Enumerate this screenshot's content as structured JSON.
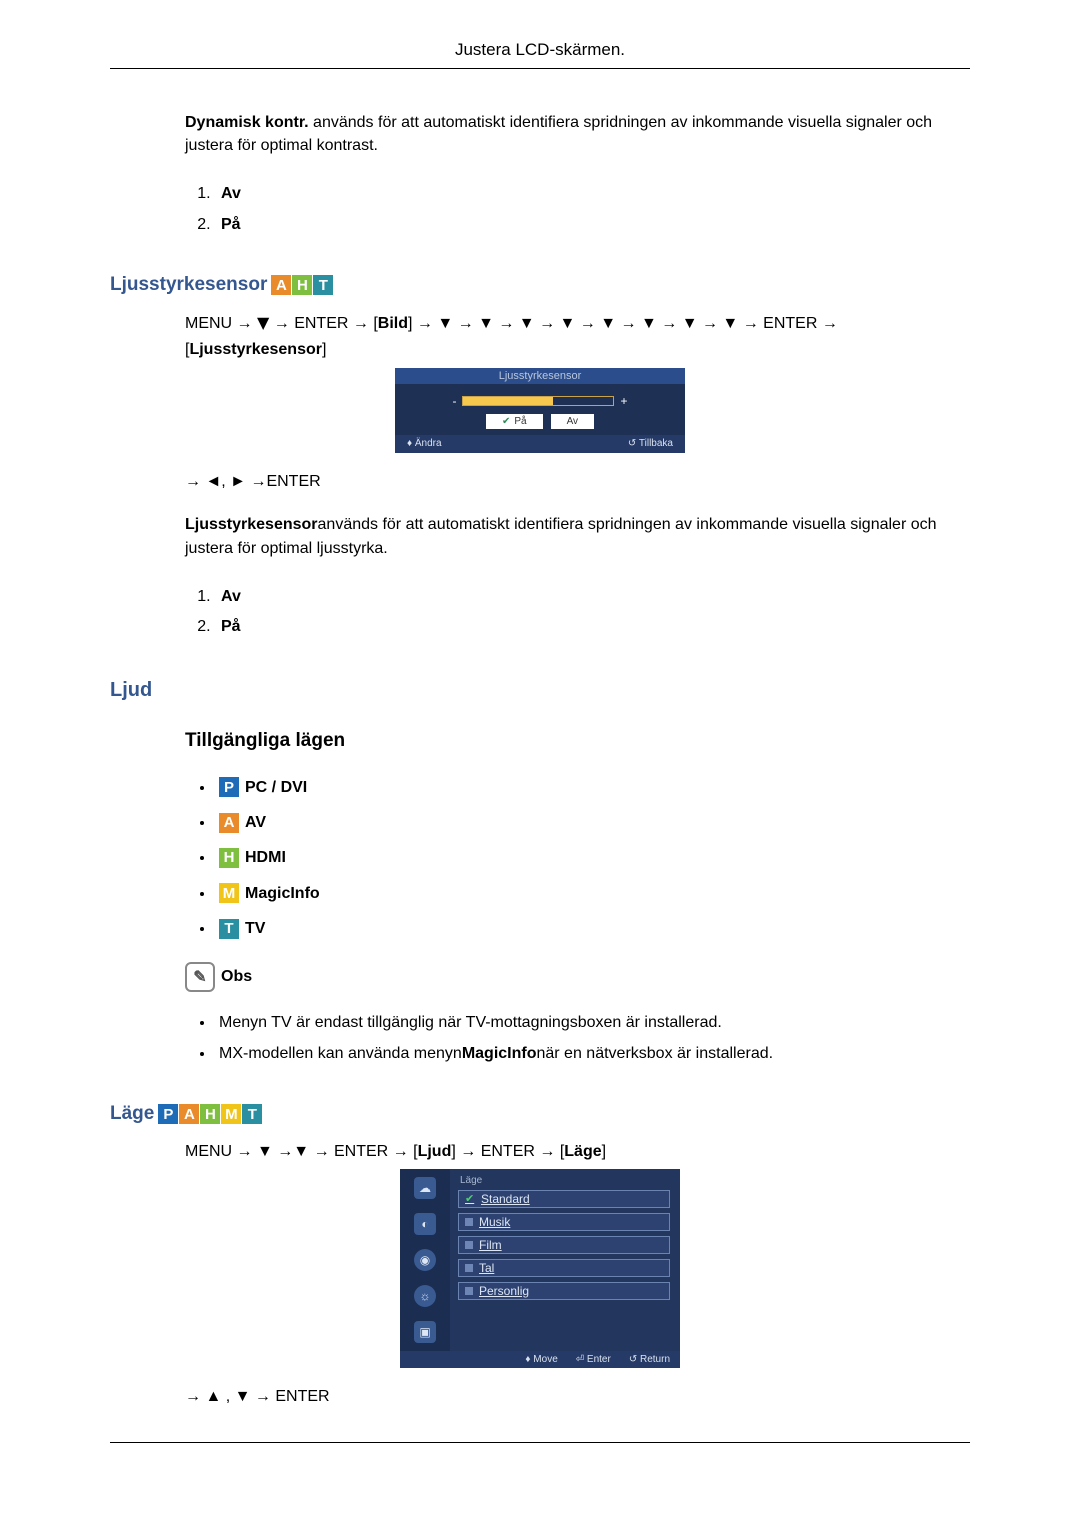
{
  "header": {
    "title": "Justera LCD-skärmen."
  },
  "dynamisk": {
    "lead_bold": "Dynamisk kontr.",
    "lead_rest": " används för att automatiskt identifiera spridningen av inkommande visuella signaler och justera för optimal kontrast.",
    "opt1": "Av",
    "opt2": "På"
  },
  "ljusstyrke": {
    "heading": "Ljusstyrkesensor",
    "nav_pre": "MENU → ",
    "nav_enter1": " → ENTER → ",
    "nav_bild": "Bild",
    "nav_post": " → ▼ → ▼ → ▼ → ▼ → ▼ → ▼ → ▼ → ▼ → ENTER → ",
    "nav_bracket": "Ljusstyrkesensor",
    "osd_title": "Ljusstyrkesensor",
    "osd_minus": "-",
    "osd_plus": "+",
    "osd_on": "På",
    "osd_off": "Av",
    "osd_footer_left": "♦ Ändra",
    "osd_footer_right": "↺ Tillbaka",
    "subnav": "→ ◄, ► →ENTER",
    "desc_bold": "Ljusstyrkesensor",
    "desc_rest": "används för att automatiskt identifiera spridningen av inkommande visuella signaler och justera för optimal ljusstyrka.",
    "opt1": "Av",
    "opt2": "På"
  },
  "ljud": {
    "heading": "Ljud",
    "subheading": "Tillgängliga lägen",
    "modes": {
      "pc": "PC / DVI",
      "av": "AV",
      "hdmi": "HDMI",
      "magic": "MagicInfo",
      "tv": "TV"
    },
    "obs_label": "Obs",
    "note1_a": "Menyn TV är endast tillgänglig när TV-mottagningsboxen är installerad.",
    "note2_a": "MX-modellen kan använda menyn",
    "note2_b": "MagicInfo",
    "note2_c": "när en nätverksbox är installerad."
  },
  "lage": {
    "heading": "Läge",
    "nav_pre": "MENU → ▼ →▼ → ENTER → ",
    "nav_ljud": "Ljud",
    "nav_mid": " → ENTER → ",
    "nav_lage": "Läge",
    "osd_caption": "Läge",
    "options": [
      "Standard",
      "Musik",
      "Film",
      "Tal",
      "Personlig"
    ],
    "footer_move": "♦ Move",
    "footer_enter": "⏎ Enter",
    "footer_return": "↺ Return",
    "subnav": "→ ▲ , ▼ → ENTER"
  },
  "icons": {
    "P": "P",
    "A": "A",
    "H": "H",
    "M": "M",
    "T": "T"
  }
}
